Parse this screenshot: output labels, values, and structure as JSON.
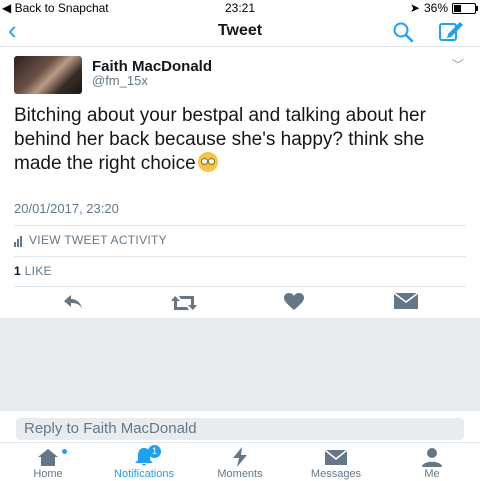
{
  "status_bar": {
    "back_to": "◀ Back to Snapchat",
    "time": "23:21",
    "battery": "36%",
    "battery_level": 0.36
  },
  "nav": {
    "back_icon": "chevron-left-icon",
    "title": "Tweet"
  },
  "tweet": {
    "author_name": "Faith MacDonald",
    "author_handle": "@fm_15x",
    "text": "Bitching about your bestpal and talking about her behind her back because she's happy? think she made the right choice",
    "timestamp": "20/01/2017, 23:20",
    "activity_label": "VIEW TWEET ACTIVITY",
    "like_count": "1",
    "like_label": "LIKE"
  },
  "reply": {
    "placeholder": "Reply to Faith MacDonald"
  },
  "tabs": [
    {
      "label": "Home",
      "icon": "home-icon"
    },
    {
      "label": "Notifications",
      "icon": "bell-icon",
      "badge": "1"
    },
    {
      "label": "Moments",
      "icon": "lightning-icon"
    },
    {
      "label": "Messages",
      "icon": "envelope-icon"
    },
    {
      "label": "Me",
      "icon": "person-icon"
    }
  ],
  "colors": {
    "accent": "#1da1f2",
    "text": "#14171a",
    "muted": "#657786",
    "panel": "#e8ecef"
  }
}
